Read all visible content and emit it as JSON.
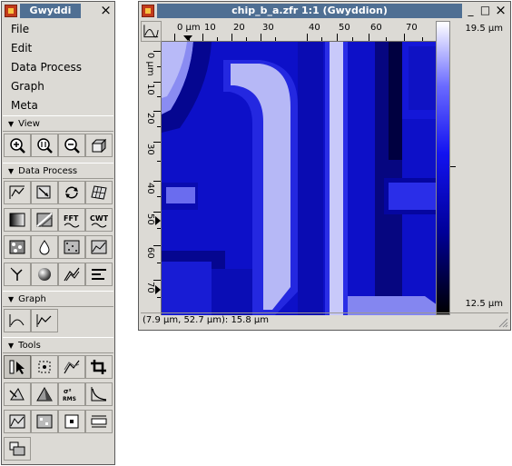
{
  "toolbox": {
    "title": "Gwyddi",
    "close_label": "×",
    "menu": [
      {
        "label": "File"
      },
      {
        "label": "Edit"
      },
      {
        "label": "Data Process"
      },
      {
        "label": "Graph"
      },
      {
        "label": "Meta"
      }
    ],
    "sections": {
      "view": "View",
      "data_process": "Data Process",
      "graph": "Graph",
      "tools": "Tools"
    }
  },
  "data_window": {
    "title": "chip_b_a.zfr 1:1 (Gwyddion)",
    "ruler_x_labels": [
      "0 µm",
      "10",
      "20",
      "30",
      "40",
      "50",
      "60",
      "70"
    ],
    "ruler_y_labels": [
      "0 µm",
      "10",
      "20",
      "30",
      "40",
      "50",
      "60",
      "70"
    ],
    "colorbar_max": "19.5 µm",
    "colorbar_min": "12.5 µm",
    "status": "(7.9 µm, 52.7 µm): 15.8 µm",
    "buttons": {
      "minimize": "_",
      "maximize": "□",
      "close": "×"
    }
  }
}
